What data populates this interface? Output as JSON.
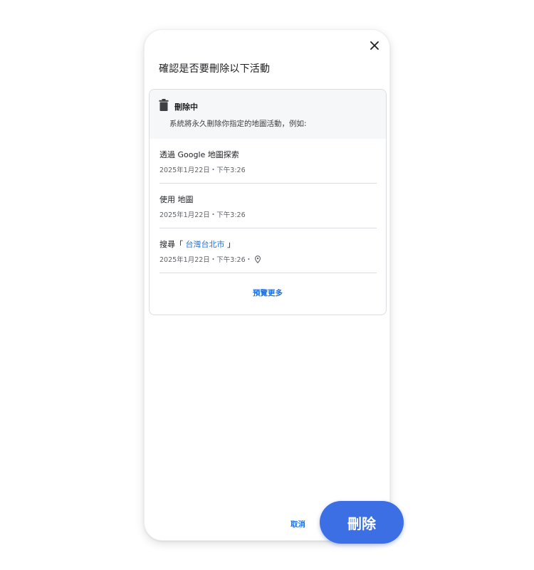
{
  "dialog": {
    "title": "確認是否要刪除以下活動"
  },
  "card": {
    "header_title": "刪除中",
    "header_desc": "系統將永久刪除你指定的地圖活動，例如:",
    "items": [
      {
        "title": "透過 Google 地圖探索",
        "meta": "2025年1月22日・下午3:26"
      },
      {
        "title": "使用 地圖",
        "meta": "2025年1月22日・下午3:26"
      },
      {
        "title_prefix": "搜尋「 ",
        "title_link": "台灣台北市",
        "title_suffix": " 」",
        "meta": "2025年1月22日・下午3:26・"
      }
    ],
    "more_label": "預覽更多"
  },
  "actions": {
    "cancel_label": "取消",
    "delete_label": "刪除"
  },
  "icons": {
    "close": "close-icon",
    "trash": "trash-icon",
    "location": "location-pin-icon"
  },
  "colors": {
    "accent": "#1a73e8",
    "delete_button": "#3d6fe4",
    "header_bg": "#f6f7f9"
  }
}
